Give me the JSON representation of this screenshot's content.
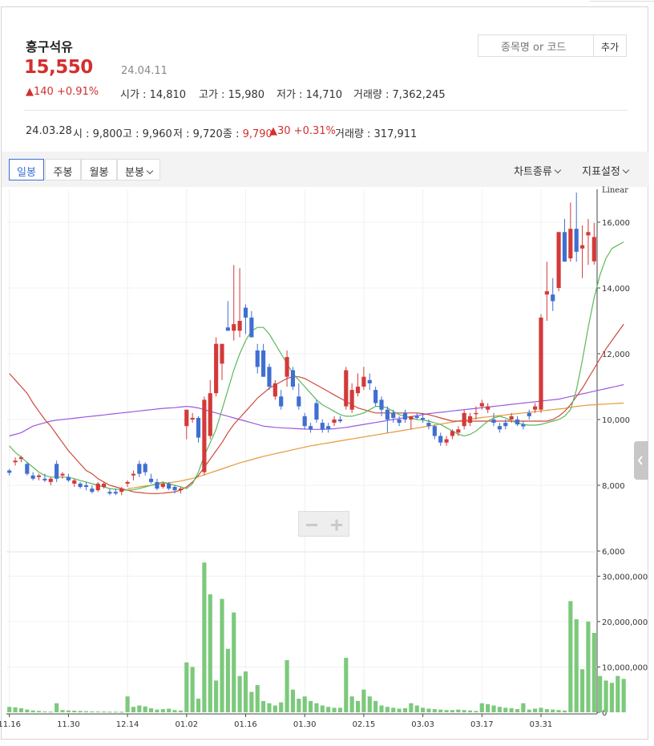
{
  "stock": {
    "name": "흥구석유",
    "price": "15,550",
    "date": "24.04.11",
    "change": "▲140 +0.91%",
    "stats": [
      {
        "label": "시가 : 14,810"
      },
      {
        "label": "고가 : 15,980"
      },
      {
        "label": "저가 : 14,710"
      },
      {
        "label": "거래량 : 7,362,245"
      }
    ]
  },
  "search": {
    "placeholder": "종목명 or 코드",
    "add_label": "추가"
  },
  "prev": {
    "date": "24.03.28",
    "open": "시 : 9,800",
    "high": "고 : 9,960",
    "low": "저 : 9,720",
    "close_label": "종 : ",
    "close_value": "9,790",
    "change": "▲30 +0.31%",
    "volume": "거래량 : 317,911"
  },
  "tabs": [
    "일봉",
    "주봉",
    "월봉",
    "분봉"
  ],
  "menus": {
    "chart_type": "차트종류",
    "indicator": "지표설정"
  },
  "colors": {
    "up": "#d33a3a",
    "down": "#3f6fd1",
    "ma5": "#5cb85c",
    "ma20": "#cc4a3a",
    "ma60": "#9b59e0",
    "ma120": "#e59a3c",
    "volume": "#7cc97c"
  },
  "chart_data": [
    {
      "type": "candlestick",
      "scale_label": "Linear",
      "y_ticks": [
        "16,000",
        "14,000",
        "12,000",
        "10,000",
        "8,000",
        "6,000"
      ],
      "ylim": [
        6000,
        17000
      ],
      "x_ticks": [
        "11.16",
        "11.30",
        "12.14",
        "01.02",
        "01.16",
        "01.30",
        "02.15",
        "03.03",
        "03.17",
        "03.31"
      ],
      "candles": [
        [
          8450,
          8500,
          8300,
          8380
        ],
        [
          8700,
          8850,
          8600,
          8750
        ],
        [
          8800,
          8900,
          8700,
          8850
        ],
        [
          8650,
          8700,
          8300,
          8350
        ],
        [
          8300,
          8400,
          8150,
          8200
        ],
        [
          8250,
          8350,
          8150,
          8300
        ],
        [
          8200,
          8350,
          8100,
          8150
        ],
        [
          8100,
          8250,
          8000,
          8200
        ],
        [
          8650,
          8750,
          8100,
          8200
        ],
        [
          8300,
          8400,
          8200,
          8350
        ],
        [
          8250,
          8350,
          8100,
          8150
        ],
        [
          8050,
          8200,
          7950,
          8150
        ],
        [
          8050,
          8100,
          7900,
          7950
        ],
        [
          8000,
          8100,
          7850,
          7950
        ],
        [
          7900,
          8000,
          7750,
          7800
        ],
        [
          7850,
          8100,
          7800,
          8050
        ],
        [
          7950,
          8100,
          7900,
          8050
        ],
        [
          7800,
          7900,
          7700,
          7750
        ],
        [
          7800,
          7900,
          7700,
          7750
        ],
        [
          7800,
          7950,
          7700,
          7900
        ],
        [
          8050,
          8150,
          7950,
          8100
        ],
        [
          8300,
          8450,
          8150,
          8350
        ],
        [
          8650,
          8750,
          8250,
          8350
        ],
        [
          8650,
          8700,
          8300,
          8400
        ],
        [
          8200,
          8350,
          8050,
          8100
        ],
        [
          8100,
          8200,
          7850,
          7900
        ],
        [
          7950,
          8100,
          7900,
          8050
        ],
        [
          8050,
          8100,
          7850,
          7900
        ],
        [
          7950,
          8000,
          7750,
          7850
        ],
        [
          7850,
          7950,
          7750,
          7900
        ],
        [
          9800,
          10200,
          9400,
          10300
        ],
        [
          10000,
          10200,
          9900,
          10050
        ],
        [
          10050,
          10100,
          9300,
          9450
        ],
        [
          8400,
          10700,
          8300,
          10600
        ],
        [
          9500,
          11200,
          9400,
          10800
        ],
        [
          10800,
          12500,
          10700,
          12300
        ],
        [
          11700,
          12300,
          11200,
          12300
        ],
        [
          12800,
          13600,
          12700,
          12700
        ],
        [
          12700,
          14700,
          12400,
          12900
        ],
        [
          12700,
          14600,
          12500,
          13000
        ],
        [
          13400,
          13500,
          12600,
          13100
        ],
        [
          13100,
          13300,
          12500,
          12500
        ],
        [
          12100,
          12300,
          11400,
          11600
        ],
        [
          12100,
          12300,
          11300,
          11300
        ],
        [
          11600,
          11700,
          10900,
          11000
        ],
        [
          10700,
          11200,
          10600,
          11100
        ],
        [
          10700,
          10900,
          10300,
          10400
        ],
        [
          11300,
          12100,
          11000,
          11900
        ],
        [
          11500,
          11600,
          10900,
          11000
        ],
        [
          10700,
          11100,
          10300,
          10400
        ],
        [
          10100,
          10200,
          9700,
          9800
        ],
        [
          9800,
          9900,
          9600,
          9700
        ],
        [
          10500,
          10600,
          9900,
          10000
        ],
        [
          9900,
          10000,
          9600,
          9700
        ],
        [
          9800,
          9900,
          9600,
          9700
        ],
        [
          9900,
          10100,
          9800,
          10000
        ],
        [
          10000,
          10100,
          9900,
          9950
        ],
        [
          10400,
          11600,
          10300,
          11500
        ],
        [
          10300,
          11100,
          10200,
          10900
        ],
        [
          10800,
          11400,
          10700,
          11000
        ],
        [
          11000,
          11600,
          10900,
          11300
        ],
        [
          11200,
          11400,
          10900,
          11100
        ],
        [
          10900,
          11000,
          10400,
          10500
        ],
        [
          10600,
          10700,
          10100,
          10300
        ],
        [
          10300,
          10400,
          9600,
          10000
        ],
        [
          10200,
          10300,
          9900,
          10050
        ],
        [
          10000,
          10100,
          9800,
          9900
        ],
        [
          10200,
          10300,
          9900,
          10000
        ],
        [
          10000,
          10100,
          9700,
          10100
        ],
        [
          10100,
          10200,
          10000,
          10050
        ],
        [
          10050,
          10200,
          9900,
          10000
        ],
        [
          9900,
          10000,
          9700,
          9800
        ],
        [
          9800,
          9850,
          9400,
          9500
        ],
        [
          9500,
          9600,
          9200,
          9300
        ],
        [
          9300,
          9500,
          9200,
          9400
        ],
        [
          9500,
          9700,
          9400,
          9650
        ],
        [
          9600,
          9800,
          9500,
          9700
        ],
        [
          9800,
          10300,
          9700,
          10200
        ],
        [
          9900,
          10200,
          9800,
          10100
        ],
        [
          10200,
          10400,
          10000,
          10200
        ],
        [
          10400,
          10600,
          10300,
          10500
        ],
        [
          10300,
          10500,
          10200,
          10400
        ],
        [
          10000,
          10200,
          9800,
          9900
        ],
        [
          9800,
          9900,
          9600,
          9700
        ],
        [
          9900,
          10000,
          9700,
          9800
        ],
        [
          10000,
          10200,
          9900,
          10100
        ],
        [
          10000,
          10100,
          9800,
          9850
        ],
        [
          9850,
          9950,
          9700,
          9790
        ],
        [
          10200,
          10300,
          10000,
          10100
        ],
        [
          10300,
          10500,
          10200,
          10400
        ],
        [
          10300,
          13200,
          10200,
          13100
        ],
        [
          13800,
          14800,
          13000,
          13900
        ],
        [
          13800,
          14300,
          13300,
          13600
        ],
        [
          14000,
          15700,
          13900,
          15700
        ],
        [
          15700,
          16100,
          14900,
          14800
        ],
        [
          14900,
          16600,
          14800,
          15800
        ],
        [
          15800,
          16900,
          14800,
          15100
        ],
        [
          15200,
          15900,
          14300,
          15300
        ],
        [
          15600,
          16100,
          14700,
          15700
        ],
        [
          14810,
          15980,
          14710,
          15550
        ]
      ],
      "ma5": [
        9200,
        9000,
        8850,
        8700,
        8550,
        8400,
        8300,
        8250,
        8250,
        8250,
        8250,
        8200,
        8150,
        8100,
        8050,
        8000,
        7950,
        7900,
        7880,
        7860,
        7850,
        7860,
        7900,
        7950,
        8000,
        8050,
        8100,
        8050,
        8000,
        7950,
        7900,
        8050,
        8400,
        8900,
        9300,
        9700,
        10300,
        10900,
        11500,
        12000,
        12400,
        12700,
        12800,
        12800,
        12600,
        12300,
        12000,
        11700,
        11400,
        11200,
        11000,
        10800,
        10600,
        10450,
        10350,
        10250,
        10150,
        10100,
        10100,
        10150,
        10200,
        10300,
        10400,
        10400,
        10350,
        10250,
        10150,
        10100,
        10050,
        10000,
        9980,
        9950,
        9900,
        9850,
        9750,
        9650,
        9550,
        9500,
        9550,
        9650,
        9800,
        9950,
        10050,
        10100,
        10050,
        9950,
        9900,
        9850,
        9830,
        9830,
        9850,
        9900,
        9950,
        10000,
        10100,
        10300,
        10900,
        11800,
        12800,
        13700,
        14400,
        14900,
        15200,
        15300,
        15400
      ],
      "ma20": [
        11400,
        11200,
        11000,
        10800,
        10500,
        10250,
        10000,
        9800,
        9550,
        9300,
        9050,
        8850,
        8650,
        8450,
        8350,
        8200,
        8100,
        8000,
        7950,
        7900,
        7850,
        7800,
        7780,
        7760,
        7750,
        7750,
        7760,
        7780,
        7800,
        7850,
        7950,
        8100,
        8300,
        8550,
        8800,
        9050,
        9300,
        9600,
        9850,
        10050,
        10250,
        10450,
        10650,
        10800,
        10950,
        11050,
        11150,
        11250,
        11300,
        11300,
        11250,
        11150,
        11050,
        10950,
        10850,
        10750,
        10650,
        10550,
        10450,
        10350,
        10300,
        10250,
        10200,
        10200,
        10200,
        10200,
        10200,
        10200,
        10200,
        10200,
        10180,
        10150,
        10100,
        10050,
        10000,
        9950,
        9950,
        9950,
        9950,
        9950,
        9950,
        9950,
        9950,
        9950,
        9950,
        9950,
        9950,
        9950,
        9950,
        9950,
        9950,
        9950,
        10000,
        10100,
        10250,
        10450,
        10700,
        10950,
        11250,
        11550,
        11850,
        12150,
        12400,
        12650,
        12900
      ],
      "ma60": [
        9500,
        9550,
        9600,
        9700,
        9800,
        9850,
        9900,
        9950,
        9980,
        10000,
        10020,
        10040,
        10060,
        10080,
        10100,
        10120,
        10140,
        10160,
        10180,
        10200,
        10220,
        10240,
        10260,
        10280,
        10300,
        10320,
        10340,
        10350,
        10360,
        10380,
        10400,
        10380,
        10350,
        10300,
        10250,
        10200,
        10150,
        10100,
        10050,
        10000,
        9950,
        9900,
        9850,
        9800,
        9780,
        9760,
        9750,
        9740,
        9730,
        9720,
        9710,
        9700,
        9700,
        9700,
        9710,
        9720,
        9740,
        9760,
        9790,
        9820,
        9850,
        9880,
        9910,
        9940,
        9970,
        10000,
        10030,
        10060,
        10090,
        10120,
        10150,
        10180,
        10200,
        10220,
        10240,
        10260,
        10280,
        10300,
        10320,
        10340,
        10360,
        10380,
        10400,
        10420,
        10440,
        10460,
        10480,
        10500,
        10520,
        10540,
        10560,
        10580,
        10600,
        10620,
        10660,
        10700,
        10740,
        10780,
        10820,
        10860,
        10900,
        10940,
        10980,
        11020,
        11060
      ],
      "ma120": [
        null,
        null,
        null,
        null,
        null,
        null,
        null,
        null,
        null,
        null,
        null,
        null,
        null,
        null,
        null,
        null,
        null,
        null,
        null,
        null,
        7900,
        7920,
        7950,
        7980,
        8000,
        8020,
        8050,
        8080,
        8100,
        8130,
        8170,
        8210,
        8260,
        8320,
        8380,
        8440,
        8500,
        8560,
        8620,
        8680,
        8730,
        8780,
        8830,
        8880,
        8920,
        8960,
        9000,
        9040,
        9080,
        9120,
        9160,
        9200,
        9230,
        9260,
        9290,
        9320,
        9350,
        9380,
        9410,
        9440,
        9470,
        9500,
        9530,
        9560,
        9590,
        9620,
        9650,
        9680,
        9710,
        9740,
        9770,
        9800,
        9830,
        9860,
        9890,
        9920,
        9950,
        9980,
        10010,
        10040,
        10060,
        10080,
        10100,
        10120,
        10140,
        10160,
        10180,
        10200,
        10220,
        10240,
        10260,
        10280,
        10300,
        10320,
        10340,
        10370,
        10400,
        10420,
        10440,
        10450,
        10460,
        10470,
        10480,
        10490,
        10500
      ]
    },
    {
      "type": "bar",
      "series_label": "volume",
      "y_ticks": [
        "30,000,000",
        "20,000,000",
        "10,000,000",
        "0"
      ],
      "ylim": [
        0,
        35000000
      ],
      "values": [
        1200000,
        1100000,
        900000,
        600000,
        400000,
        300000,
        200000,
        150000,
        2000000,
        500000,
        400000,
        350000,
        300000,
        250000,
        200000,
        180000,
        160000,
        140000,
        130000,
        120000,
        3500000,
        1200000,
        1500000,
        1300000,
        900000,
        600000,
        700000,
        800000,
        500000,
        400000,
        11000000,
        10000000,
        3000000,
        33000000,
        26000000,
        7000000,
        25000000,
        14000000,
        22000000,
        8000000,
        9000000,
        4500000,
        6000000,
        2500000,
        2000000,
        1500000,
        2200000,
        11500000,
        5000000,
        3000000,
        3500000,
        2500000,
        2000000,
        1500000,
        1200000,
        1000000,
        1000000,
        12000000,
        3500000,
        2500000,
        5000000,
        3500000,
        2500000,
        1500000,
        1200000,
        1000000,
        800000,
        900000,
        2000000,
        1500000,
        1000000,
        800000,
        700000,
        600000,
        500000,
        500000,
        600000,
        500000,
        400000,
        300000,
        2000000,
        1800000,
        1500000,
        1200000,
        1000000,
        900000,
        700000,
        2000000,
        600000,
        800000,
        1000000,
        700000,
        600000,
        500000,
        400000,
        24500000,
        20500000,
        9500000,
        20000000,
        17500000,
        8000000,
        7000000,
        6500000,
        8000000,
        7362245
      ]
    }
  ]
}
